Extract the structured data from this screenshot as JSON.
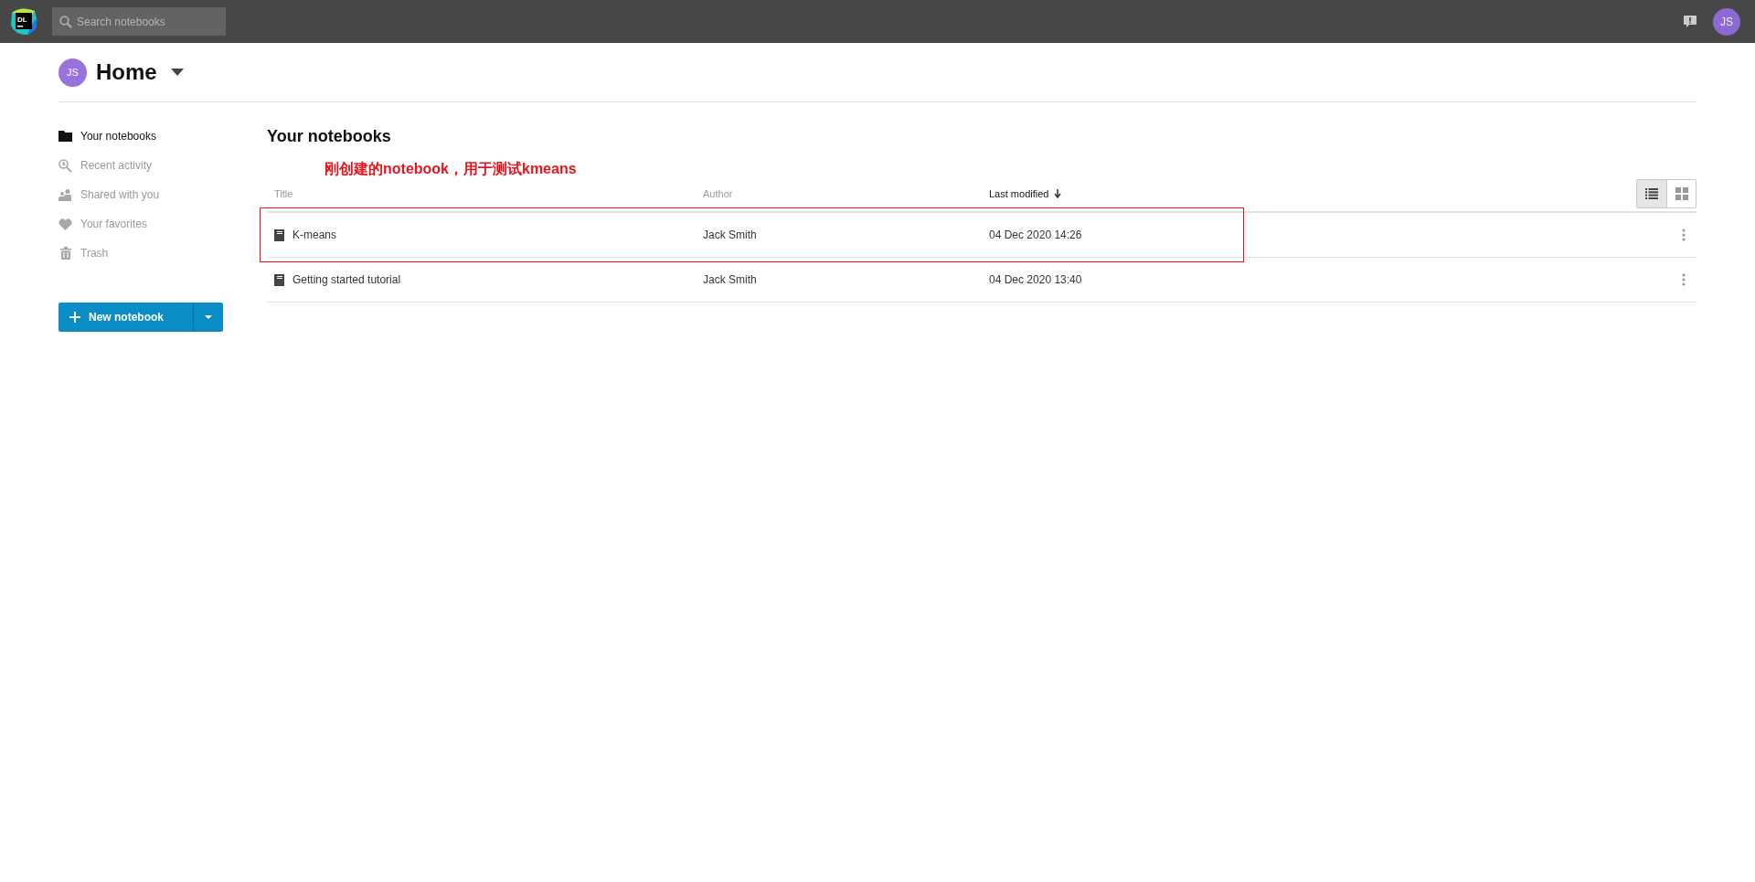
{
  "topbar": {
    "logo": "DL",
    "search": {
      "placeholder": "Search notebooks"
    },
    "avatar": "JS"
  },
  "header": {
    "avatar": "JS",
    "title": "Home"
  },
  "sidebar": {
    "items": [
      {
        "label": "Your notebooks",
        "kind": "folder",
        "selected": true
      },
      {
        "label": "Recent activity",
        "kind": "recent",
        "selected": false
      },
      {
        "label": "Shared with you",
        "kind": "shared",
        "selected": false
      },
      {
        "label": "Your favorites",
        "kind": "favorite",
        "selected": false
      },
      {
        "label": "Trash",
        "kind": "trash",
        "selected": false
      }
    ],
    "new_button": "New notebook"
  },
  "main": {
    "title": "Your notebooks",
    "annotation": "刚创建的notebook，用于测试kmeans",
    "columns": [
      {
        "label": "Title",
        "sorted": false
      },
      {
        "label": "Author",
        "sorted": false
      },
      {
        "label": "Last modified",
        "sorted": true
      }
    ],
    "view_modes": [
      {
        "kind": "list",
        "selected": true
      },
      {
        "kind": "grid",
        "selected": false
      }
    ],
    "rows": [
      {
        "title": "K-means",
        "author": "Jack Smith",
        "modified": "04 Dec 2020 14:26",
        "highlighted": true
      },
      {
        "title": "Getting started tutorial",
        "author": "Jack Smith",
        "modified": "04 Dec 2020 13:40",
        "highlighted": false
      }
    ]
  }
}
